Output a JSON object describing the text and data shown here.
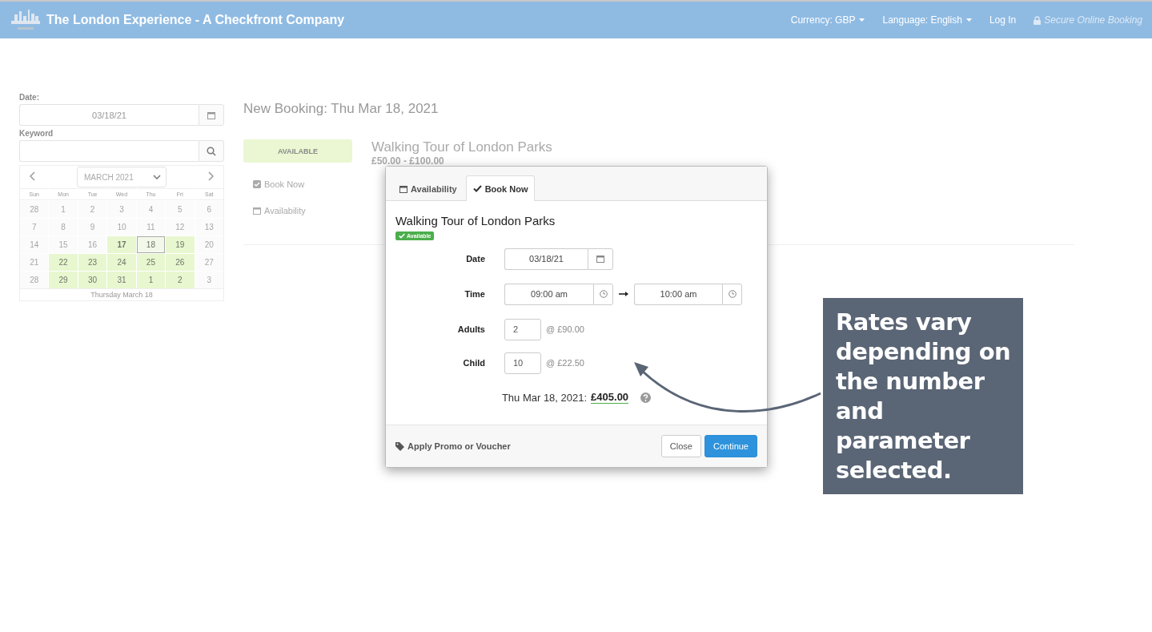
{
  "header": {
    "title": "The London Experience - A Checkfront Company",
    "currency": "Currency: GBP",
    "language": "Language: English",
    "login": "Log In",
    "secure": "Secure Online Booking"
  },
  "sidebar": {
    "date_label": "Date:",
    "date_value": "03/18/21",
    "keyword_label": "Keyword",
    "calendar": {
      "month": "MARCH 2021",
      "weekdays": [
        "Sun",
        "Mon",
        "Tue",
        "Wed",
        "Thu",
        "Fri",
        "Sat"
      ],
      "weeks": [
        [
          {
            "label": "28",
            "available": false,
            "today": false,
            "selected": false
          },
          {
            "label": "1",
            "available": false,
            "today": false,
            "selected": false
          },
          {
            "label": "2",
            "available": false,
            "today": false,
            "selected": false
          },
          {
            "label": "3",
            "available": false,
            "today": false,
            "selected": false
          },
          {
            "label": "4",
            "available": false,
            "today": false,
            "selected": false
          },
          {
            "label": "5",
            "available": false,
            "today": false,
            "selected": false
          },
          {
            "label": "6",
            "available": false,
            "today": false,
            "selected": false
          }
        ],
        [
          {
            "label": "7",
            "available": false,
            "today": false,
            "selected": false
          },
          {
            "label": "8",
            "available": false,
            "today": false,
            "selected": false
          },
          {
            "label": "9",
            "available": false,
            "today": false,
            "selected": false
          },
          {
            "label": "10",
            "available": false,
            "today": false,
            "selected": false
          },
          {
            "label": "11",
            "available": false,
            "today": false,
            "selected": false
          },
          {
            "label": "12",
            "available": false,
            "today": false,
            "selected": false
          },
          {
            "label": "13",
            "available": false,
            "today": false,
            "selected": false
          }
        ],
        [
          {
            "label": "14",
            "available": false,
            "today": false,
            "selected": false
          },
          {
            "label": "15",
            "available": false,
            "today": false,
            "selected": false
          },
          {
            "label": "16",
            "available": false,
            "today": false,
            "selected": false
          },
          {
            "label": "17",
            "available": true,
            "today": true,
            "selected": false
          },
          {
            "label": "18",
            "available": true,
            "today": false,
            "selected": true
          },
          {
            "label": "19",
            "available": true,
            "today": false,
            "selected": false
          },
          {
            "label": "20",
            "available": false,
            "today": false,
            "selected": false
          }
        ],
        [
          {
            "label": "21",
            "available": false,
            "today": false,
            "selected": false
          },
          {
            "label": "22",
            "available": true,
            "today": false,
            "selected": false
          },
          {
            "label": "23",
            "available": true,
            "today": false,
            "selected": false
          },
          {
            "label": "24",
            "available": true,
            "today": false,
            "selected": false
          },
          {
            "label": "25",
            "available": true,
            "today": false,
            "selected": false
          },
          {
            "label": "26",
            "available": true,
            "today": false,
            "selected": false
          },
          {
            "label": "27",
            "available": false,
            "today": false,
            "selected": false
          }
        ],
        [
          {
            "label": "28",
            "available": false,
            "today": false,
            "selected": false
          },
          {
            "label": "29",
            "available": true,
            "today": false,
            "selected": false
          },
          {
            "label": "30",
            "available": true,
            "today": false,
            "selected": false
          },
          {
            "label": "31",
            "available": true,
            "today": false,
            "selected": false
          },
          {
            "label": "1",
            "available": true,
            "today": false,
            "selected": false
          },
          {
            "label": "2",
            "available": true,
            "today": false,
            "selected": false
          },
          {
            "label": "3",
            "available": false,
            "today": false,
            "selected": false
          }
        ]
      ],
      "footer": "Thursday March 18"
    }
  },
  "main": {
    "heading": "New Booking: Thu Mar 18, 2021",
    "status": "AVAILABLE",
    "links": [
      "Book Now",
      "Availability"
    ],
    "item_title": "Walking Tour of London Parks",
    "item_price": "£50.00 - £100.00"
  },
  "modal": {
    "tabs": [
      {
        "label": "Availability",
        "selected": false
      },
      {
        "label": "Book Now",
        "selected": true
      }
    ],
    "title": "Walking Tour of London Parks",
    "badge": "Available",
    "date_label": "Date",
    "date_value": "03/18/21",
    "time_label": "Time",
    "time_start": "09:00 am",
    "time_end": "10:00 am",
    "rates": [
      {
        "label": "Adults",
        "qty": "2",
        "price": "@ £90.00"
      },
      {
        "label": "Child",
        "qty": "10",
        "price": "@ £22.50"
      }
    ],
    "total_label": "Thu Mar 18, 2021:",
    "total": "£405.00",
    "promo": "Apply Promo or Voucher",
    "close": "Close",
    "continue": "Continue"
  },
  "callout": {
    "text": "Rates vary depending on the number and parameter selected."
  }
}
